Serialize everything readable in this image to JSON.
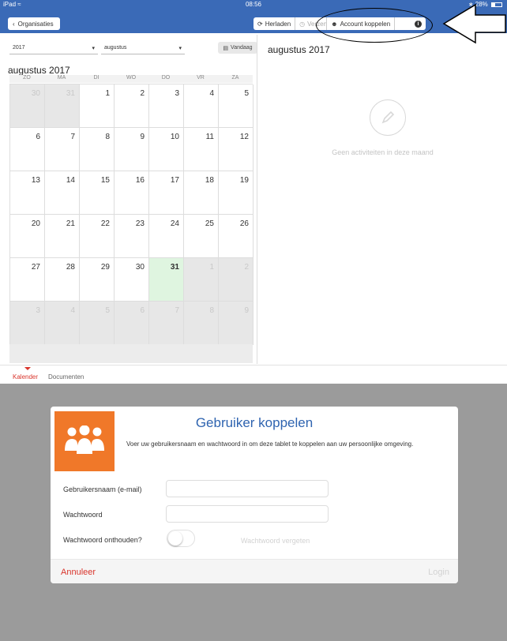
{
  "status_bar": {
    "device": "iPad",
    "time": "08:56",
    "battery": "28%"
  },
  "nav": {
    "org_button": "Organisaties",
    "reload_button": "Herladen",
    "send_button": "Verzenden",
    "account_button": "Account koppelen"
  },
  "calendar": {
    "year_select": "2017",
    "month_select": "augustus",
    "today_button": "Vandaag",
    "month_title": "augustus 2017",
    "weekdays": [
      "ZO",
      "MA",
      "DI",
      "WO",
      "DO",
      "VR",
      "ZA"
    ],
    "days": [
      {
        "d": "30",
        "out": true
      },
      {
        "d": "31",
        "out": true
      },
      {
        "d": "1"
      },
      {
        "d": "2"
      },
      {
        "d": "3"
      },
      {
        "d": "4"
      },
      {
        "d": "5"
      },
      {
        "d": "6"
      },
      {
        "d": "7"
      },
      {
        "d": "8"
      },
      {
        "d": "9"
      },
      {
        "d": "10"
      },
      {
        "d": "11"
      },
      {
        "d": "12"
      },
      {
        "d": "13"
      },
      {
        "d": "14"
      },
      {
        "d": "15"
      },
      {
        "d": "16"
      },
      {
        "d": "17"
      },
      {
        "d": "18"
      },
      {
        "d": "19"
      },
      {
        "d": "20"
      },
      {
        "d": "21"
      },
      {
        "d": "22"
      },
      {
        "d": "23"
      },
      {
        "d": "24"
      },
      {
        "d": "25"
      },
      {
        "d": "26"
      },
      {
        "d": "27"
      },
      {
        "d": "28"
      },
      {
        "d": "29"
      },
      {
        "d": "30"
      },
      {
        "d": "31",
        "today": true
      },
      {
        "d": "1",
        "out": true
      },
      {
        "d": "2",
        "out": true
      },
      {
        "d": "3",
        "out": true
      },
      {
        "d": "4",
        "out": true
      },
      {
        "d": "5",
        "out": true
      },
      {
        "d": "6",
        "out": true
      },
      {
        "d": "7",
        "out": true
      },
      {
        "d": "8",
        "out": true
      },
      {
        "d": "9",
        "out": true
      }
    ]
  },
  "right_pane": {
    "title": "augustus 2017",
    "empty_message": "Geen activiteiten in deze maand"
  },
  "tabs": {
    "calendar": "Kalender",
    "documents": "Documenten"
  },
  "modal": {
    "title": "Gebruiker koppelen",
    "description": "Voer uw gebruikersnaam en wachtwoord in om deze tablet te koppelen aan uw persoonlijke omgeving.",
    "username_label": "Gebruikersnaam (e-mail)",
    "username_value": "",
    "password_label": "Wachtwoord",
    "password_value": "",
    "remember_label": "Wachtwoord onthouden?",
    "remember_on": false,
    "forgot_link": "Wachtwoord vergeten",
    "cancel_button": "Annuleer",
    "login_button": "Login"
  },
  "colors": {
    "nav_blue": "#3a6ab7",
    "accent_red": "#d9342b",
    "title_blue": "#2f64b0",
    "logo_orange": "#f07829",
    "today_green": "#dff5e0"
  }
}
